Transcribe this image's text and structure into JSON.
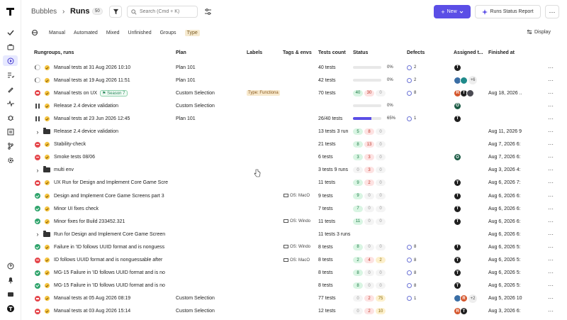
{
  "breadcrumb": {
    "root": "Bubbles",
    "separator": "›",
    "current": "Runs",
    "count": "50"
  },
  "search": {
    "placeholder": "Search (Cmd + K)"
  },
  "actions": {
    "new_label": "New",
    "report_label": "Runs Status Report",
    "more": "···"
  },
  "tabs": [
    {
      "label": "Manual",
      "active": false
    },
    {
      "label": "Automated",
      "active": false
    },
    {
      "label": "Mixed",
      "active": false
    },
    {
      "label": "Unfinished",
      "active": false
    },
    {
      "label": "Groups",
      "active": false
    },
    {
      "label": "Type",
      "active": true
    }
  ],
  "display_label": "Display",
  "columns": {
    "name": "Rungroups, runs",
    "plan": "Plan",
    "labels": "Labels",
    "tags": "Tags & envs",
    "count": "Tests count",
    "status": "Status",
    "defects": "Defects",
    "assigned": "Assigned t...",
    "finished": "Finished at"
  },
  "rows": [
    {
      "state": "progress",
      "kind": "run",
      "name": "Manual tests at 31 Aug 2026 10:10",
      "plan": "Plan 101",
      "count": "40 tests",
      "status": {
        "type": "bar",
        "pct": 0,
        "label": "0%"
      },
      "defects": "2",
      "assignees": [
        "T"
      ],
      "finished": ""
    },
    {
      "state": "progress",
      "kind": "run",
      "name": "Manual tests at 19 Aug 2026 11:51",
      "plan": "Plan 101",
      "count": "42 tests",
      "status": {
        "type": "bar",
        "pct": 0,
        "label": "0%"
      },
      "defects": "2",
      "assignees": [
        "blue",
        "teal"
      ],
      "more": "+6",
      "finished": ""
    },
    {
      "state": "failed",
      "kind": "run",
      "name": "Manual tests on UX",
      "milestone": "Season 7",
      "plan": "Custom Selection",
      "label": "Type: Functiona",
      "count": "70 tests",
      "status": {
        "type": "pills",
        "pills": [
          [
            "g",
            "40"
          ],
          [
            "r",
            "30"
          ],
          [
            "zero",
            "0"
          ]
        ]
      },
      "defects": "8",
      "assignees": [
        "R",
        "T",
        "gray"
      ],
      "finished": "Aug 18, 2026 ..."
    },
    {
      "state": "paused",
      "kind": "run",
      "name": "Release 2.4 device validation",
      "plan": "Custom Selection",
      "count": "",
      "status": {
        "type": "bar",
        "pct": 0,
        "label": "0%"
      },
      "defects": "",
      "assignees": [
        "O"
      ],
      "finished": ""
    },
    {
      "state": "paused",
      "kind": "run",
      "name": "Manual tests at 23 Jun 2026 12:45",
      "plan": "Plan 101",
      "count": "26/40 tests",
      "status": {
        "type": "bar",
        "pct": 65,
        "label": "65%"
      },
      "defects": "1",
      "assignees": [
        "T"
      ],
      "finished": ""
    },
    {
      "state": "expand",
      "kind": "group",
      "name": "Release 2.4 device validation",
      "plan": "",
      "count": "13 tests 3 run",
      "status": {
        "type": "pills",
        "pills": [
          [
            "g",
            "5"
          ],
          [
            "r",
            "8"
          ],
          [
            "zero",
            "0"
          ]
        ]
      },
      "defects": "",
      "assignees": [],
      "finished": "Aug 11, 2026 9"
    },
    {
      "state": "failed",
      "kind": "run",
      "name": "Stability-check",
      "plan": "",
      "count": "21 tests",
      "status": {
        "type": "pills",
        "pills": [
          [
            "g",
            "8"
          ],
          [
            "r",
            "13"
          ],
          [
            "zero",
            "0"
          ]
        ]
      },
      "defects": "",
      "assignees": [],
      "finished": "Aug 7, 2026 6:"
    },
    {
      "state": "failed",
      "kind": "run",
      "name": "Smoke tests 08/06",
      "plan": "",
      "count": "6 tests",
      "status": {
        "type": "pills",
        "pills": [
          [
            "g",
            "3"
          ],
          [
            "r",
            "3"
          ],
          [
            "zero",
            "0"
          ]
        ]
      },
      "defects": "",
      "assignees": [
        "O"
      ],
      "finished": "Aug 7, 2026 6:"
    },
    {
      "state": "expand",
      "kind": "group",
      "name": "multi env",
      "plan": "",
      "count": "3 tests 9 runs",
      "status": {
        "type": "pills",
        "pills": [
          [
            "zero",
            "0"
          ],
          [
            "r",
            "3"
          ],
          [
            "zero",
            "0"
          ]
        ]
      },
      "defects": "",
      "assignees": [],
      "finished": "Aug 3, 2026 4:"
    },
    {
      "state": "failed",
      "kind": "run",
      "name": "UX Run for Design and Implement Core Game Scre",
      "plan": "",
      "count": "11 tests",
      "status": {
        "type": "pills",
        "pills": [
          [
            "g",
            "9"
          ],
          [
            "r",
            "2"
          ],
          [
            "zero",
            "0"
          ]
        ]
      },
      "defects": "",
      "assignees": [
        "T"
      ],
      "finished": "Aug 6, 2026 7:"
    },
    {
      "state": "passed",
      "kind": "run",
      "name": "Design and Implement Core Game Screens part 3",
      "plan": "",
      "tag": "OS: MacO",
      "count": "9 tests",
      "status": {
        "type": "pills",
        "pills": [
          [
            "g",
            "9"
          ],
          [
            "zero",
            "0"
          ],
          [
            "zero",
            "0"
          ]
        ]
      },
      "defects": "",
      "assignees": [
        "T"
      ],
      "finished": "Aug 6, 2026 6:"
    },
    {
      "state": "passed",
      "kind": "run",
      "name": "Minor UI fixes check",
      "plan": "",
      "count": "7 tests",
      "status": {
        "type": "pills",
        "pills": [
          [
            "g",
            "7"
          ],
          [
            "zero",
            "0"
          ],
          [
            "zero",
            "0"
          ]
        ]
      },
      "defects": "",
      "assignees": [
        "T"
      ],
      "finished": "Aug 6, 2026 6:"
    },
    {
      "state": "passed",
      "kind": "run",
      "name": "Minor fixes for Build 233452.321",
      "plan": "",
      "tag": "OS: Windo",
      "count": "11 tests",
      "status": {
        "type": "pills",
        "pills": [
          [
            "g",
            "11"
          ],
          [
            "zero",
            "0"
          ],
          [
            "zero",
            "0"
          ]
        ]
      },
      "defects": "",
      "assignees": [
        "T"
      ],
      "finished": "Aug 6, 2026 6:"
    },
    {
      "state": "expand",
      "kind": "group",
      "name": "Run for Design and Implement Core Game Screen",
      "plan": "",
      "count": "11 tests 3 runs",
      "status": {
        "type": "none"
      },
      "defects": "",
      "assignees": [],
      "finished": "Aug 6, 2026 6:"
    },
    {
      "state": "passed",
      "kind": "run",
      "name": "Failure in 'ID follows UUID format and is nonguess",
      "plan": "",
      "tag": "OS: Windo",
      "count": "8 tests",
      "status": {
        "type": "pills",
        "pills": [
          [
            "g",
            "8"
          ],
          [
            "zero",
            "0"
          ],
          [
            "zero",
            "0"
          ]
        ]
      },
      "defects": "8",
      "assignees": [
        "T"
      ],
      "finished": "Aug 6, 2026 5:"
    },
    {
      "state": "failed",
      "kind": "run",
      "name": "ID follows UUID format and is nonguessable after",
      "plan": "",
      "tag": "OS: MacO",
      "count": "8 tests",
      "status": {
        "type": "pills",
        "pills": [
          [
            "g",
            "2"
          ],
          [
            "r",
            "4"
          ],
          [
            "y",
            "2"
          ]
        ]
      },
      "defects": "8",
      "assignees": [
        "T"
      ],
      "finished": "Aug 6, 2026 5:"
    },
    {
      "state": "passed",
      "kind": "run",
      "name": "MG-15 Failure in 'ID follows UUID format and is no",
      "plan": "",
      "count": "8 tests",
      "status": {
        "type": "pills",
        "pills": [
          [
            "g",
            "8"
          ],
          [
            "zero",
            "0"
          ],
          [
            "zero",
            "0"
          ]
        ]
      },
      "defects": "8",
      "assignees": [
        "T"
      ],
      "finished": "Aug 6, 2026 5:"
    },
    {
      "state": "passed",
      "kind": "run",
      "name": "MG-15 Failure in 'ID follows UUID format and is no",
      "plan": "",
      "count": "8 tests",
      "status": {
        "type": "pills",
        "pills": [
          [
            "g",
            "8"
          ],
          [
            "zero",
            "0"
          ],
          [
            "zero",
            "0"
          ]
        ]
      },
      "defects": "8",
      "assignees": [
        "T"
      ],
      "finished": "Aug 6, 2026 5:"
    },
    {
      "state": "failed",
      "kind": "run",
      "name": "Manual tests at 05 Aug 2026 08:19",
      "plan": "Custom Selection",
      "count": "77 tests",
      "status": {
        "type": "pills",
        "pills": [
          [
            "zero",
            "0"
          ],
          [
            "r",
            "2"
          ],
          [
            "y",
            "75"
          ]
        ]
      },
      "defects": "1",
      "assignees": [
        "blue",
        "R"
      ],
      "more": "+2",
      "finished": "Aug 5, 2026 10"
    },
    {
      "state": "failed",
      "kind": "run",
      "name": "Manual tests at 03 Aug 2026 15:14",
      "plan": "Custom Selection",
      "count": "12 tests",
      "status": {
        "type": "pills",
        "pills": [
          [
            "zero",
            "0"
          ],
          [
            "r",
            "2"
          ],
          [
            "y",
            "10"
          ]
        ]
      },
      "defects": "",
      "assignees": [
        "R",
        "T"
      ],
      "finished": "Aug 3, 2026 6:"
    }
  ],
  "colors": {
    "accent": "#5b4ee6",
    "passed": "#30a46c",
    "failed": "#e5484d"
  }
}
